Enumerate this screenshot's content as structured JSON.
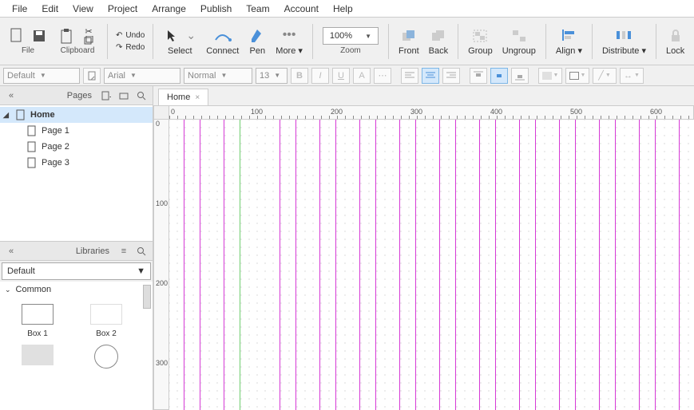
{
  "menu": [
    "File",
    "Edit",
    "View",
    "Project",
    "Arrange",
    "Publish",
    "Team",
    "Account",
    "Help"
  ],
  "toolbar": {
    "file": "File",
    "clipboard": "Clipboard",
    "undo": "Undo",
    "redo": "Redo",
    "select": "Select",
    "connect": "Connect",
    "pen": "Pen",
    "more": "More ▾",
    "zoom_val": "100%",
    "zoom": "Zoom",
    "front": "Front",
    "back": "Back",
    "group": "Group",
    "ungroup": "Ungroup",
    "align": "Align ▾",
    "distribute": "Distribute ▾",
    "lock": "Lock"
  },
  "fmt": {
    "style": "Default",
    "font": "Arial",
    "weight": "Normal",
    "size": "13"
  },
  "pages": {
    "title": "Pages",
    "items": [
      "Home",
      "Page 1",
      "Page 2",
      "Page 3"
    ],
    "selected": 0
  },
  "lib": {
    "title": "Libraries",
    "selected": "Default",
    "cat": "Common",
    "shapes": [
      "Box 1",
      "Box 2"
    ]
  },
  "tab": "Home",
  "ruler_h": [
    0,
    100,
    200,
    300,
    400,
    500,
    600
  ],
  "ruler_v": [
    0,
    100,
    200,
    300
  ],
  "guides": [
    18,
    38,
    68,
    88,
    138,
    158,
    188,
    208,
    238,
    258,
    288,
    308,
    338,
    358,
    388,
    408,
    438,
    458,
    488,
    508,
    538,
    558,
    588,
    608,
    638
  ]
}
